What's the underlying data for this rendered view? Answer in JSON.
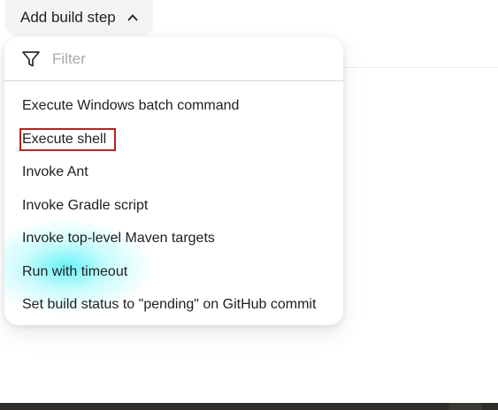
{
  "toolbar": {
    "add_build_step_label": "Add build step",
    "chevron_icon": "chevron-up-icon"
  },
  "menu": {
    "filter": {
      "icon": "filter-icon",
      "placeholder": "Filter",
      "value": ""
    },
    "items": [
      {
        "label": "Execute Windows batch command"
      },
      {
        "label": "Execute shell",
        "highlighted": true
      },
      {
        "label": "Invoke Ant"
      },
      {
        "label": "Invoke Gradle script"
      },
      {
        "label": "Invoke top-level Maven targets"
      },
      {
        "label": "Run with timeout"
      },
      {
        "label": "Set build status to \"pending\" on GitHub commit"
      }
    ]
  },
  "colors": {
    "highlight_border": "#b3261e",
    "placeholder_text": "#a9a9b0",
    "glow": "#50f0f5"
  }
}
